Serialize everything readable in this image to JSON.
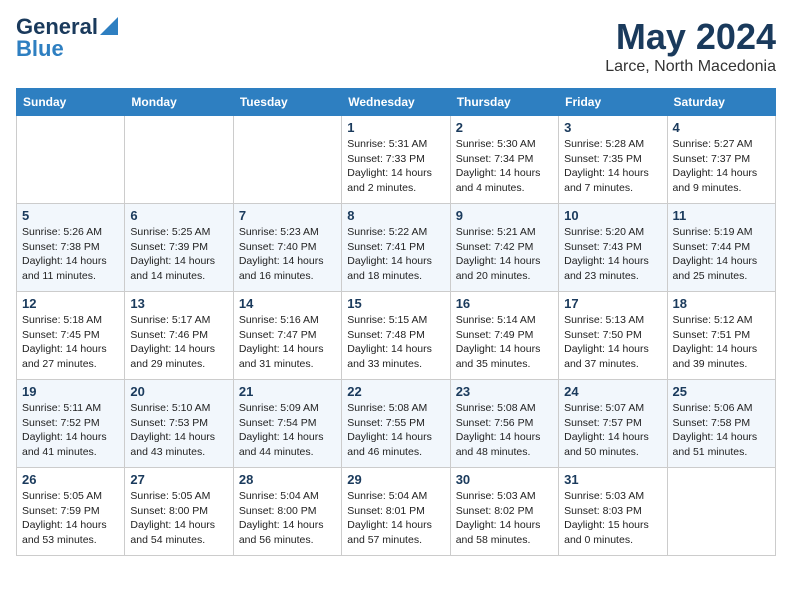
{
  "header": {
    "logo_line1": "General",
    "logo_line2": "Blue",
    "month_year": "May 2024",
    "location": "Larce, North Macedonia"
  },
  "days_of_week": [
    "Sunday",
    "Monday",
    "Tuesday",
    "Wednesday",
    "Thursday",
    "Friday",
    "Saturday"
  ],
  "weeks": [
    [
      {
        "num": "",
        "info": ""
      },
      {
        "num": "",
        "info": ""
      },
      {
        "num": "",
        "info": ""
      },
      {
        "num": "1",
        "info": "Sunrise: 5:31 AM\nSunset: 7:33 PM\nDaylight: 14 hours\nand 2 minutes."
      },
      {
        "num": "2",
        "info": "Sunrise: 5:30 AM\nSunset: 7:34 PM\nDaylight: 14 hours\nand 4 minutes."
      },
      {
        "num": "3",
        "info": "Sunrise: 5:28 AM\nSunset: 7:35 PM\nDaylight: 14 hours\nand 7 minutes."
      },
      {
        "num": "4",
        "info": "Sunrise: 5:27 AM\nSunset: 7:37 PM\nDaylight: 14 hours\nand 9 minutes."
      }
    ],
    [
      {
        "num": "5",
        "info": "Sunrise: 5:26 AM\nSunset: 7:38 PM\nDaylight: 14 hours\nand 11 minutes."
      },
      {
        "num": "6",
        "info": "Sunrise: 5:25 AM\nSunset: 7:39 PM\nDaylight: 14 hours\nand 14 minutes."
      },
      {
        "num": "7",
        "info": "Sunrise: 5:23 AM\nSunset: 7:40 PM\nDaylight: 14 hours\nand 16 minutes."
      },
      {
        "num": "8",
        "info": "Sunrise: 5:22 AM\nSunset: 7:41 PM\nDaylight: 14 hours\nand 18 minutes."
      },
      {
        "num": "9",
        "info": "Sunrise: 5:21 AM\nSunset: 7:42 PM\nDaylight: 14 hours\nand 20 minutes."
      },
      {
        "num": "10",
        "info": "Sunrise: 5:20 AM\nSunset: 7:43 PM\nDaylight: 14 hours\nand 23 minutes."
      },
      {
        "num": "11",
        "info": "Sunrise: 5:19 AM\nSunset: 7:44 PM\nDaylight: 14 hours\nand 25 minutes."
      }
    ],
    [
      {
        "num": "12",
        "info": "Sunrise: 5:18 AM\nSunset: 7:45 PM\nDaylight: 14 hours\nand 27 minutes."
      },
      {
        "num": "13",
        "info": "Sunrise: 5:17 AM\nSunset: 7:46 PM\nDaylight: 14 hours\nand 29 minutes."
      },
      {
        "num": "14",
        "info": "Sunrise: 5:16 AM\nSunset: 7:47 PM\nDaylight: 14 hours\nand 31 minutes."
      },
      {
        "num": "15",
        "info": "Sunrise: 5:15 AM\nSunset: 7:48 PM\nDaylight: 14 hours\nand 33 minutes."
      },
      {
        "num": "16",
        "info": "Sunrise: 5:14 AM\nSunset: 7:49 PM\nDaylight: 14 hours\nand 35 minutes."
      },
      {
        "num": "17",
        "info": "Sunrise: 5:13 AM\nSunset: 7:50 PM\nDaylight: 14 hours\nand 37 minutes."
      },
      {
        "num": "18",
        "info": "Sunrise: 5:12 AM\nSunset: 7:51 PM\nDaylight: 14 hours\nand 39 minutes."
      }
    ],
    [
      {
        "num": "19",
        "info": "Sunrise: 5:11 AM\nSunset: 7:52 PM\nDaylight: 14 hours\nand 41 minutes."
      },
      {
        "num": "20",
        "info": "Sunrise: 5:10 AM\nSunset: 7:53 PM\nDaylight: 14 hours\nand 43 minutes."
      },
      {
        "num": "21",
        "info": "Sunrise: 5:09 AM\nSunset: 7:54 PM\nDaylight: 14 hours\nand 44 minutes."
      },
      {
        "num": "22",
        "info": "Sunrise: 5:08 AM\nSunset: 7:55 PM\nDaylight: 14 hours\nand 46 minutes."
      },
      {
        "num": "23",
        "info": "Sunrise: 5:08 AM\nSunset: 7:56 PM\nDaylight: 14 hours\nand 48 minutes."
      },
      {
        "num": "24",
        "info": "Sunrise: 5:07 AM\nSunset: 7:57 PM\nDaylight: 14 hours\nand 50 minutes."
      },
      {
        "num": "25",
        "info": "Sunrise: 5:06 AM\nSunset: 7:58 PM\nDaylight: 14 hours\nand 51 minutes."
      }
    ],
    [
      {
        "num": "26",
        "info": "Sunrise: 5:05 AM\nSunset: 7:59 PM\nDaylight: 14 hours\nand 53 minutes."
      },
      {
        "num": "27",
        "info": "Sunrise: 5:05 AM\nSunset: 8:00 PM\nDaylight: 14 hours\nand 54 minutes."
      },
      {
        "num": "28",
        "info": "Sunrise: 5:04 AM\nSunset: 8:00 PM\nDaylight: 14 hours\nand 56 minutes."
      },
      {
        "num": "29",
        "info": "Sunrise: 5:04 AM\nSunset: 8:01 PM\nDaylight: 14 hours\nand 57 minutes."
      },
      {
        "num": "30",
        "info": "Sunrise: 5:03 AM\nSunset: 8:02 PM\nDaylight: 14 hours\nand 58 minutes."
      },
      {
        "num": "31",
        "info": "Sunrise: 5:03 AM\nSunset: 8:03 PM\nDaylight: 15 hours\nand 0 minutes."
      },
      {
        "num": "",
        "info": ""
      }
    ]
  ]
}
